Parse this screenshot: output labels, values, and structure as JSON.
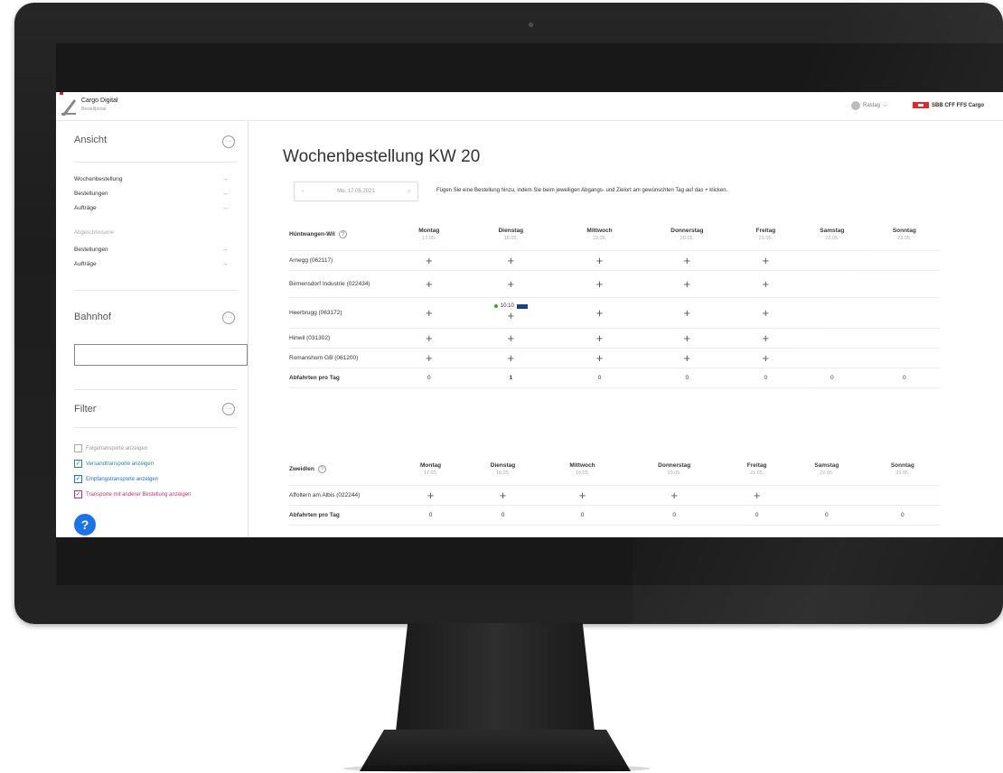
{
  "header": {
    "app_title": "Cargo Digital",
    "app_subtitle": "Bestellportal",
    "user": "Rastag",
    "brand": "SBB CFF FFS Cargo"
  },
  "sidebar": {
    "ansicht": {
      "title": "Ansicht",
      "items": [
        {
          "label": "Wochenbestellung",
          "arrow": "→"
        },
        {
          "label": "Bestellungen",
          "arrow": "→"
        },
        {
          "label": "Aufträge",
          "arrow": "→"
        }
      ],
      "caption": "Abgeschlossene",
      "closed_items": [
        {
          "label": "Bestellungen",
          "arrow": "→"
        },
        {
          "label": "Aufträge",
          "arrow": "→"
        }
      ]
    },
    "bahnhof": {
      "title": "Bahnhof",
      "input_value": ""
    },
    "filter": {
      "title": "Filter",
      "options": [
        {
          "label": "Folgetransporte anzeigen",
          "checked": false,
          "color": "#999999"
        },
        {
          "label": "Versandtransporte anzeigen",
          "checked": true,
          "color": "#2a8a8a"
        },
        {
          "label": "Empfangstransporte anzeigen",
          "checked": true,
          "color": "#1a73e8"
        },
        {
          "label": "Transporte mit anderer Bestellung anzeigen",
          "checked": true,
          "color": "#c2337a"
        }
      ]
    },
    "help_label": "?",
    "more_label": "···"
  },
  "main": {
    "title": "Wochenbestellung  KW 20",
    "date": "Mo, 17.05.2021",
    "date_prev": "‹",
    "date_next": "›",
    "hint": "Fügen Sie eine Bestellung hinzu, indem Sie beim jeweiligen Abgangs- und Zielort am gewünschten Tag auf das + klicken.",
    "days": [
      {
        "name": "Montag",
        "date": "17.05."
      },
      {
        "name": "Dienstag",
        "date": "18.05."
      },
      {
        "name": "Mittwoch",
        "date": "19.05."
      },
      {
        "name": "Donnerstag",
        "date": "20.05."
      },
      {
        "name": "Freitag",
        "date": "21.05."
      },
      {
        "name": "Samstag",
        "date": "22.05."
      },
      {
        "name": "Sonntag",
        "date": "23.05."
      }
    ],
    "sections": [
      {
        "station": "Hüntwangen-Wil",
        "rows": [
          "Arnegg (062117)",
          "Birmensdorf Industrie (022434)",
          "Heerbrugg (063172)",
          "Hinwil (031302)",
          "Romanshorn GB (061200)"
        ],
        "order": {
          "time": "10:10"
        },
        "sum_label": "Abfahrten pro Tag",
        "sums": [
          "0",
          "1",
          "0",
          "0",
          "0",
          "0",
          "0"
        ]
      },
      {
        "station": "Zweidlen",
        "rows": [
          "Affoltern am Albis (022244)"
        ],
        "sum_label": "Abfahrten pro Tag",
        "sums": [
          "0",
          "0",
          "0",
          "0",
          "0",
          "0",
          "0"
        ]
      }
    ],
    "plus": "+"
  }
}
